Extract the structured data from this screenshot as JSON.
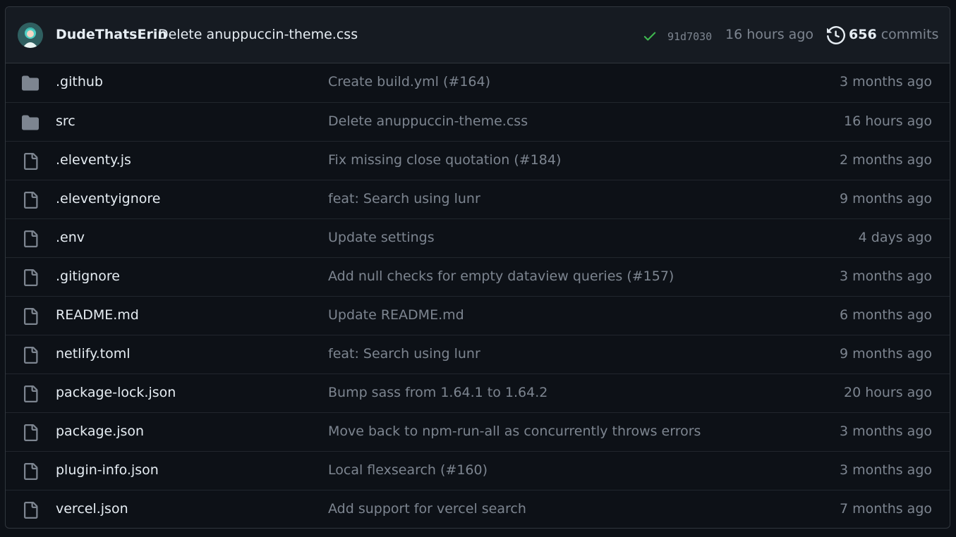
{
  "latest_commit": {
    "author": "DudeThatsErin",
    "message": "Delete anuppuccin-theme.css",
    "status_icon": "check-icon",
    "status_color": "#3fb950",
    "sha": "91d7030",
    "time": "16 hours ago",
    "commits_count": "656",
    "commits_label": "commits"
  },
  "files": [
    {
      "type": "folder",
      "icon": "folder-icon",
      "name": ".github",
      "message": "Create build.yml (#164)",
      "time": "3 months ago"
    },
    {
      "type": "folder",
      "icon": "folder-icon",
      "name": "src",
      "message": "Delete anuppuccin-theme.css",
      "time": "16 hours ago"
    },
    {
      "type": "file",
      "icon": "file-icon",
      "name": ".eleventy.js",
      "message": "Fix missing close quotation (#184)",
      "time": "2 months ago"
    },
    {
      "type": "file",
      "icon": "file-icon",
      "name": ".eleventyignore",
      "message": "feat: Search using lunr",
      "time": "9 months ago"
    },
    {
      "type": "file",
      "icon": "file-icon",
      "name": ".env",
      "message": "Update settings",
      "time": "4 days ago"
    },
    {
      "type": "file",
      "icon": "file-icon",
      "name": ".gitignore",
      "message": "Add null checks for empty dataview queries (#157)",
      "time": "3 months ago"
    },
    {
      "type": "file",
      "icon": "file-icon",
      "name": "README.md",
      "message": "Update README.md",
      "time": "6 months ago"
    },
    {
      "type": "file",
      "icon": "file-icon",
      "name": "netlify.toml",
      "message": "feat: Search using lunr",
      "time": "9 months ago"
    },
    {
      "type": "file",
      "icon": "file-icon",
      "name": "package-lock.json",
      "message": "Bump sass from 1.64.1 to 1.64.2",
      "time": "20 hours ago"
    },
    {
      "type": "file",
      "icon": "file-icon",
      "name": "package.json",
      "message": "Move back to npm-run-all as concurrently throws errors",
      "time": "3 months ago"
    },
    {
      "type": "file",
      "icon": "file-icon",
      "name": "plugin-info.json",
      "message": "Local flexsearch (#160)",
      "time": "3 months ago"
    },
    {
      "type": "file",
      "icon": "file-icon",
      "name": "vercel.json",
      "message": "Add support for vercel search",
      "time": "7 months ago"
    }
  ]
}
